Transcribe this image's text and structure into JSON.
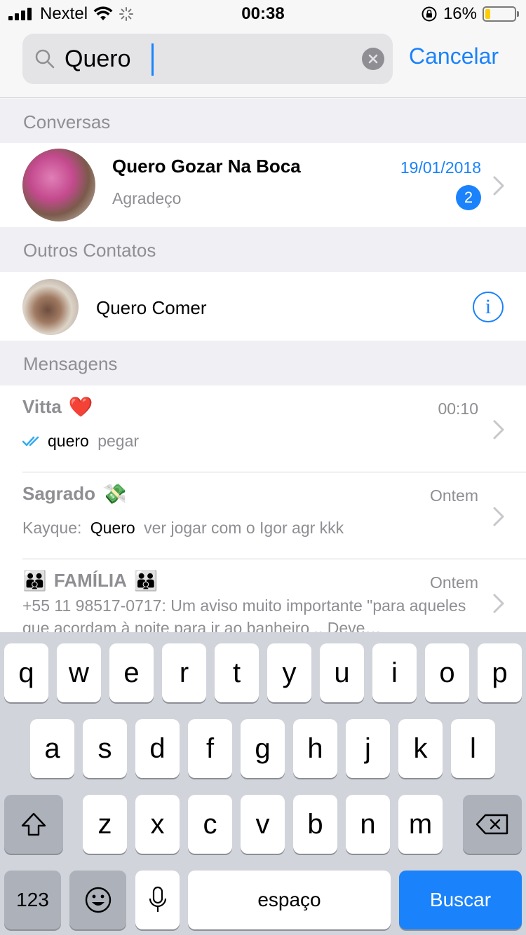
{
  "status_bar": {
    "carrier": "Nextel",
    "time": "00:38",
    "battery": "16%",
    "icons": [
      "signal-icon",
      "wifi-icon",
      "activity-spinner-icon",
      "rotation-lock-icon",
      "battery-icon"
    ]
  },
  "search": {
    "query": "Quero",
    "cancel_label": "Cancelar"
  },
  "sections": {
    "chats": "Conversas",
    "contacts": "Outros Contatos",
    "messages": "Mensagens"
  },
  "chat": {
    "name": "Quero Gozar Na Boca",
    "date": "19/01/2018",
    "preview": "Agradeço",
    "unread": "2"
  },
  "contact": {
    "name": "Quero Comer"
  },
  "messages": [
    {
      "title": "Vitta",
      "emoji": "❤️",
      "time": "00:10",
      "match": "quero",
      "rest": " pegar"
    },
    {
      "title": "Sagrado",
      "emoji": "💸",
      "time": "Ontem",
      "sender": "Kayque: ",
      "match": "Quero",
      "rest": " ver jogar com o Igor agr kkk"
    },
    {
      "title": "FAMÍLIA",
      "emoji_left": "👪",
      "emoji_right": "👪",
      "time": "Ontem",
      "body": "+55 11 98517-0717: Um aviso muito importante \"para aqueles que acordam à noite para ir ao banheiro .. Deve…"
    }
  ],
  "keyboard": {
    "row1": [
      "q",
      "w",
      "e",
      "r",
      "t",
      "y",
      "u",
      "i",
      "o",
      "p"
    ],
    "row2": [
      "a",
      "s",
      "d",
      "f",
      "g",
      "h",
      "j",
      "k",
      "l"
    ],
    "row3": [
      "z",
      "x",
      "c",
      "v",
      "b",
      "n",
      "m"
    ],
    "numbers_label": "123",
    "space_label": "espaço",
    "search_label": "Buscar"
  },
  "colors": {
    "accent": "#1a82fb",
    "secondary_text": "#8e8e93",
    "battery_low": "#ffcc00"
  }
}
